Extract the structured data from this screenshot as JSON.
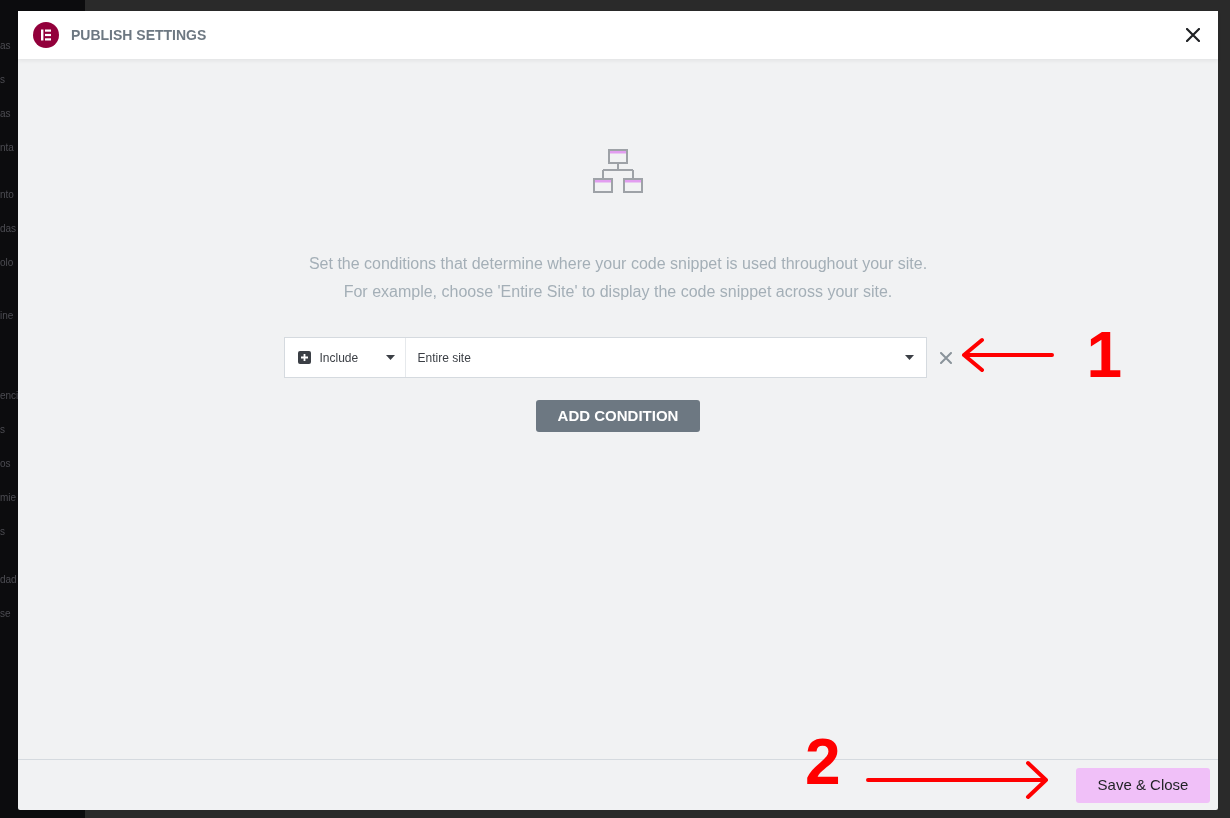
{
  "background": {
    "sidebar_groups": [
      {
        "items": [
          {
            "label": "as"
          },
          {
            "label": "s"
          },
          {
            "label": "as"
          },
          {
            "label": "nta"
          }
        ]
      },
      {
        "items": [
          {
            "label": "nto"
          },
          {
            "label": "das"
          },
          {
            "label": "olo"
          }
        ]
      },
      {
        "items": [
          {
            "label": "ine"
          }
        ]
      },
      {
        "items": [
          {
            "label": "enci"
          },
          {
            "label": "s"
          },
          {
            "label": "os"
          },
          {
            "label": "mie"
          },
          {
            "label": "s"
          }
        ]
      },
      {
        "items": [
          {
            "label": "dad"
          },
          {
            "label": "se"
          }
        ]
      }
    ]
  },
  "dialog": {
    "title": "PUBLISH SETTINGS",
    "description": [
      "Set the conditions that determine where your code snippet is used throughout your site.",
      "For example, choose 'Entire Site' to display the code snippet across your site."
    ],
    "conditions": [
      {
        "type": "Include",
        "target": "Entire site"
      }
    ],
    "add_button": "ADD CONDITION",
    "save_button": "Save & Close"
  },
  "annotations": [
    {
      "kind": "left",
      "label": "1"
    },
    {
      "kind": "right",
      "label": "2"
    }
  ]
}
